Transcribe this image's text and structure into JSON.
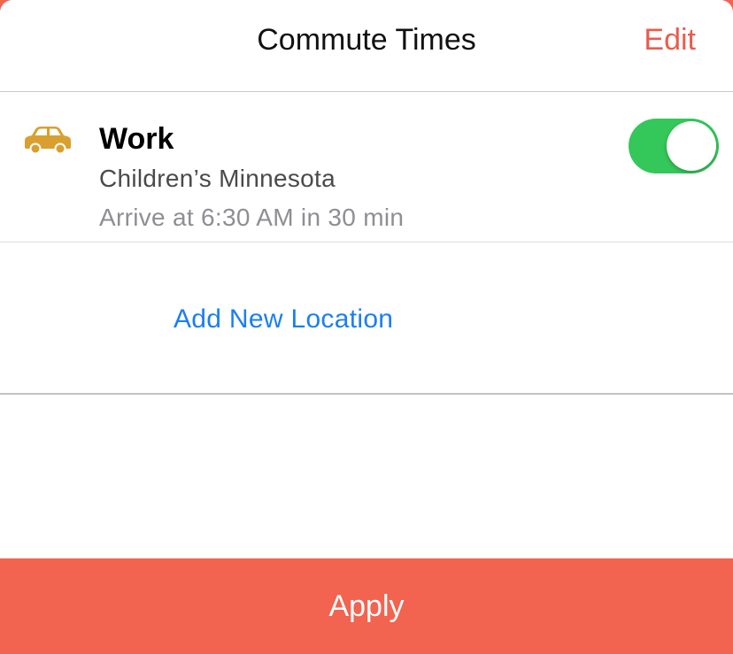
{
  "header": {
    "title": "Commute Times",
    "edit_label": "Edit"
  },
  "commute_item": {
    "icon": "car-icon",
    "icon_color": "#d9a030",
    "title": "Work",
    "location": "Children’s Minnesota",
    "detail": "Arrive at 6:30 AM in 30 min",
    "enabled": true,
    "toggle_color": "#34c759"
  },
  "add_location_label": "Add New Location",
  "apply_label": "Apply",
  "colors": {
    "accent": "#ec5b4b",
    "apply_background": "#f26350",
    "link": "#1a7ff2"
  }
}
